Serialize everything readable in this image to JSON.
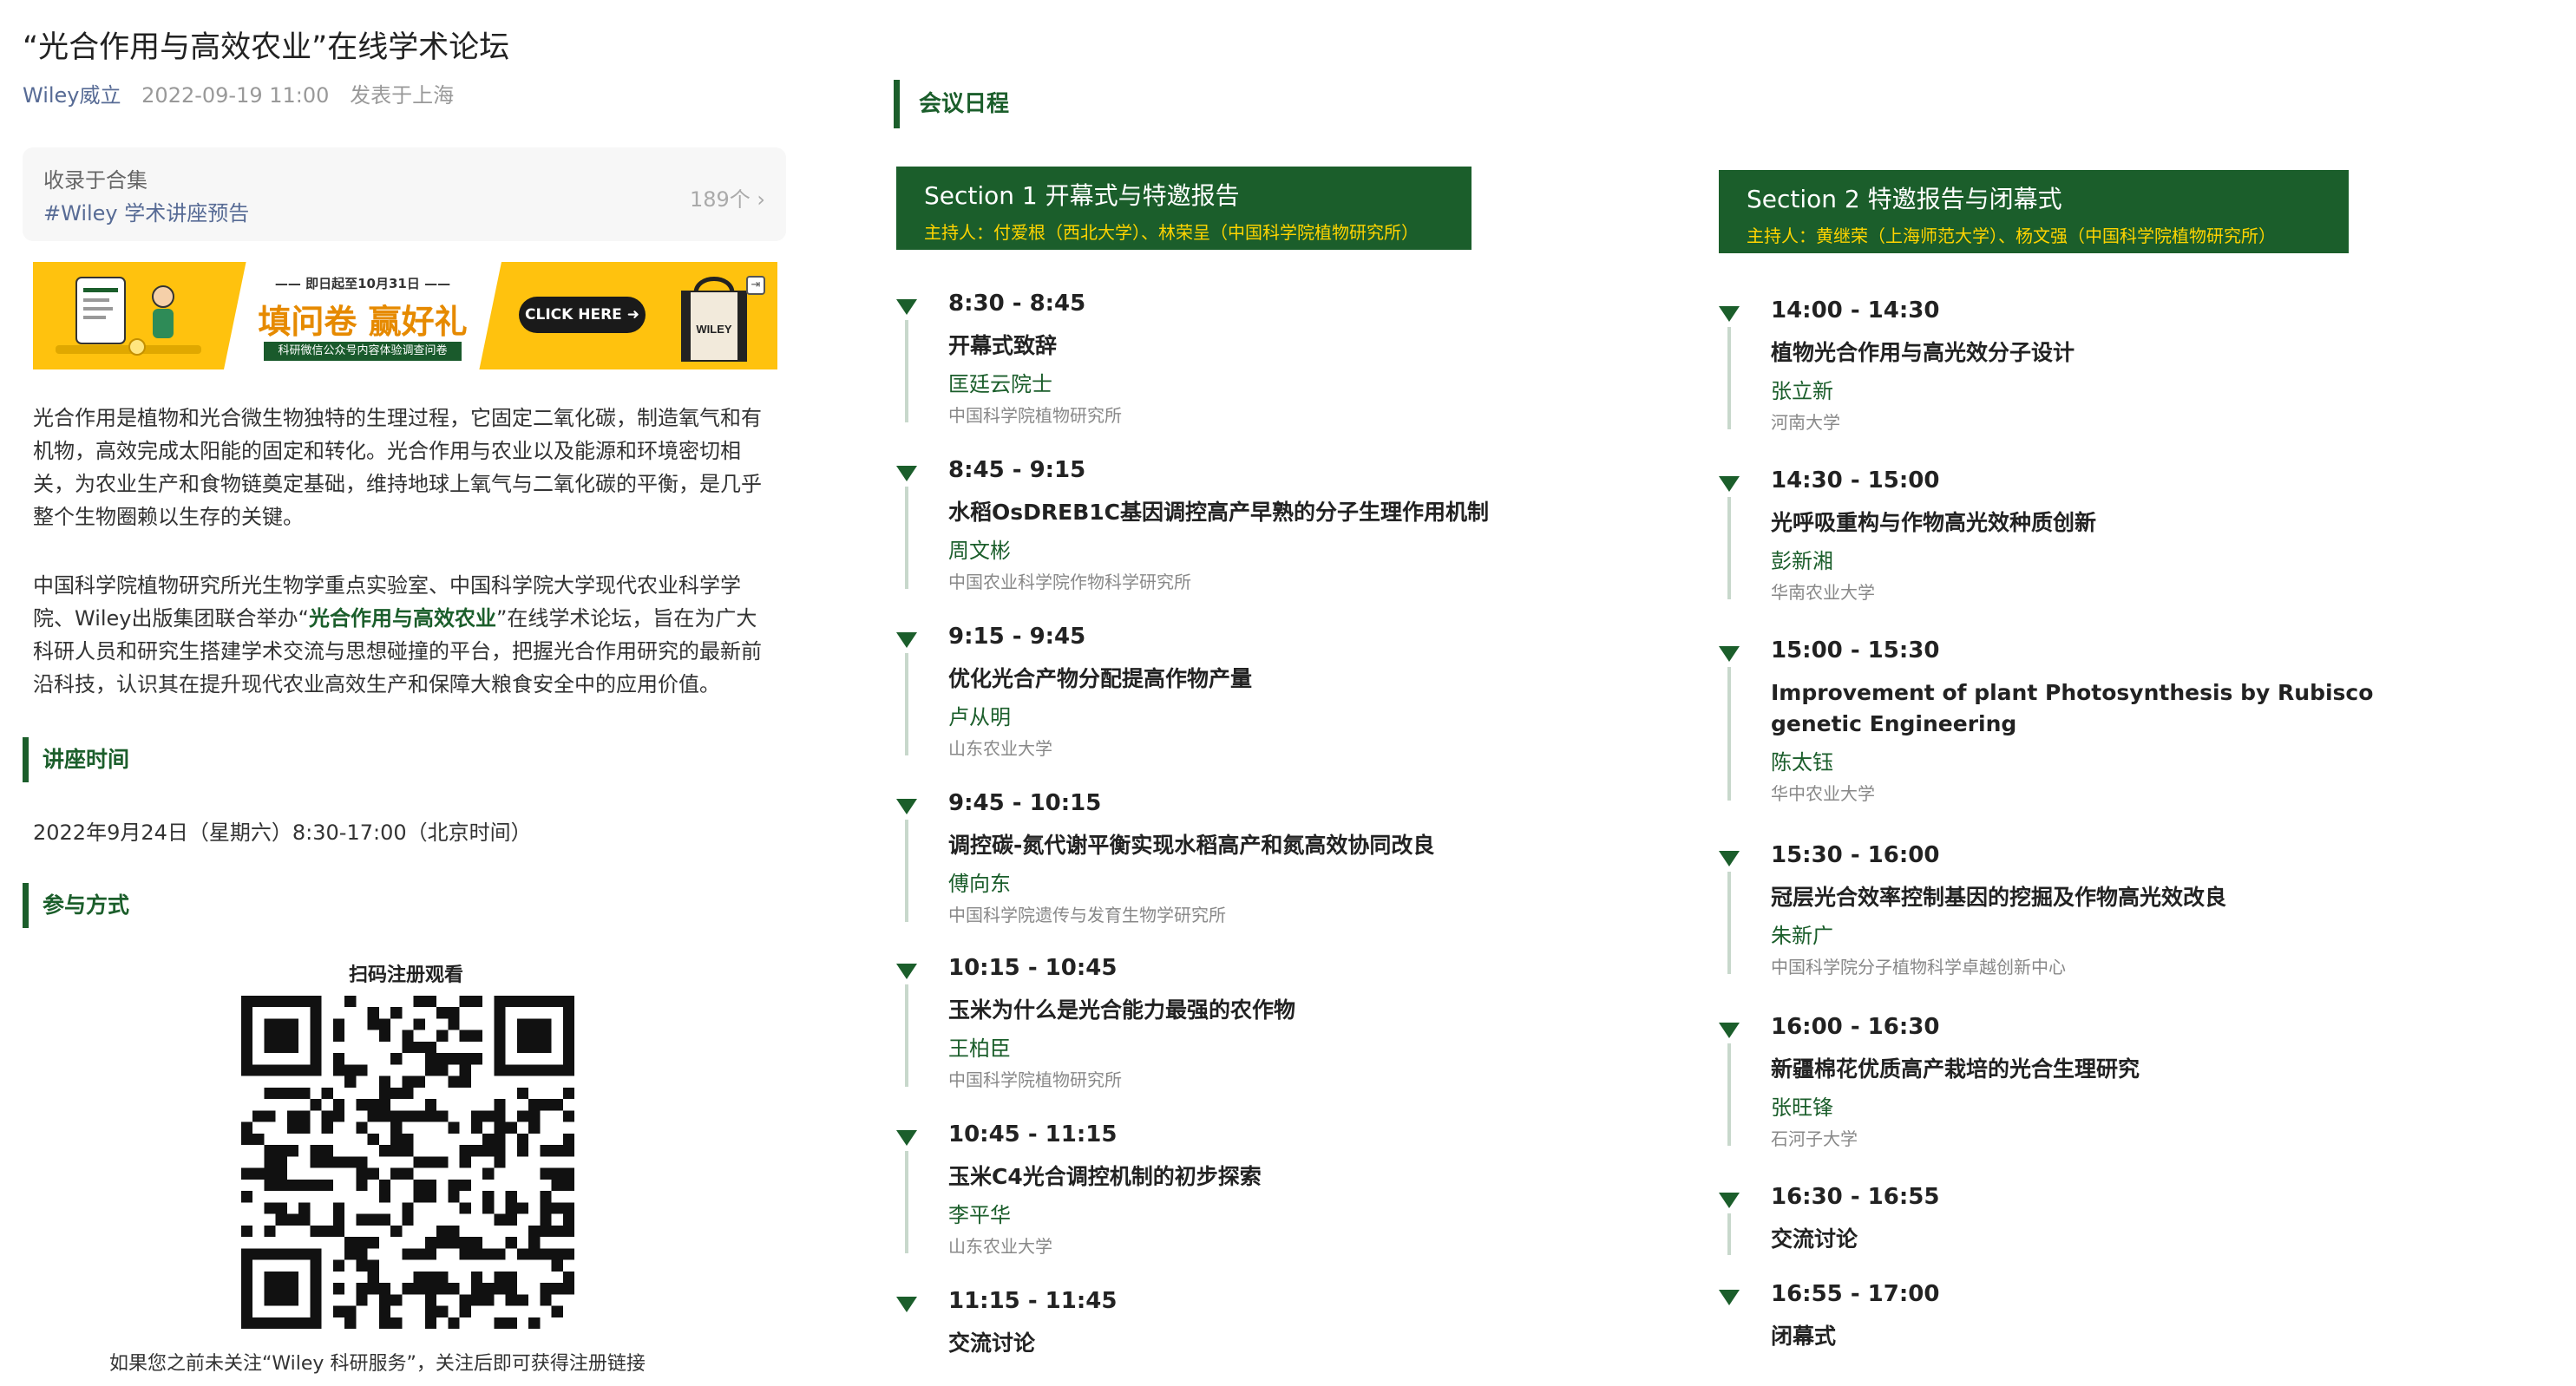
{
  "article": {
    "title": "“光合作用与高效农业”在线学术论坛",
    "author": "Wiley威立",
    "date": "2022-09-19 11:00",
    "location": "发表于上海"
  },
  "collection": {
    "label": "收录于合集",
    "tag": "#Wiley 学术讲座预告",
    "count": "189个 ›"
  },
  "banner": {
    "top_text": "—— 即日起至10月31日 ——",
    "main_text": "填问卷 赢好礼",
    "sub_text": "科研微信公众号内容体验调查问卷",
    "cta": "CLICK HERE ➜",
    "bag_text": "WILEY",
    "corner_icon": "exit-icon"
  },
  "intro": {
    "p1": "光合作用是植物和光合微生物独特的生理过程，它固定二氧化碳，制造氧气和有机物，高效完成太阳能的固定和转化。光合作用与农业以及能源和环境密切相关，为农业生产和食物链奠定基础，维持地球上氧气与二氧化碳的平衡，是几乎整个生物圈赖以生存的关键。",
    "p2_before": "中国科学院植物研究所光生物学重点实验室、中国科学院大学现代农业科学学院、Wiley出版集团联合举办“",
    "p2_highlight": "光合作用与高效农业",
    "p2_after": "”在线学术论坛，旨在为广大科研人员和研究生搭建学术交流与思想碰撞的平台，把握光合作用研究的最新前沿科技，认识其在提升现代农业高效生产和保障大粮食安全中的应用价值。"
  },
  "lecture_time": {
    "heading": "讲座时间",
    "text": "2022年9月24日（星期六）8:30-17:00（北京时间）"
  },
  "participation": {
    "heading": "参与方式",
    "qr_label": "扫码注册观看",
    "note": "如果您之前未关注“Wiley 科研服务”，关注后即可获得注册链接"
  },
  "agenda": {
    "heading": "会议日程",
    "sections": [
      {
        "title": "Section 1 开幕式与特邀报告",
        "hosts": "主持人：付爱根（西北大学）、林荣呈（中国科学院植物研究所）",
        "items": [
          {
            "time": "8:30 - 8:45",
            "topic": "开幕式致辞",
            "speaker": "匡廷云院士",
            "affiliation": "中国科学院植物研究所"
          },
          {
            "time": "8:45 - 9:15",
            "topic": "水稻OsDREB1C基因调控高产早熟的分子生理作用机制",
            "speaker": "周文彬",
            "affiliation": "中国农业科学院作物科学研究所"
          },
          {
            "time": "9:15 - 9:45",
            "topic": "优化光合产物分配提高作物产量",
            "speaker": "卢从明",
            "affiliation": "山东农业大学"
          },
          {
            "time": "9:45 - 10:15",
            "topic": "调控碳-氮代谢平衡实现水稻高产和氮高效协同改良",
            "speaker": "傅向东",
            "affiliation": "中国科学院遗传与发育生物学研究所"
          },
          {
            "time": "10:15 - 10:45",
            "topic": "玉米为什么是光合能力最强的农作物",
            "speaker": "王柏臣",
            "affiliation": "中国科学院植物研究所"
          },
          {
            "time": "10:45 - 11:15",
            "topic": "玉米C4光合调控机制的初步探索",
            "speaker": "李平华",
            "affiliation": "山东农业大学"
          },
          {
            "time": "11:15 - 11:45",
            "topic": "交流讨论",
            "speaker": "",
            "affiliation": ""
          }
        ]
      },
      {
        "title": "Section 2 特邀报告与闭幕式",
        "hosts": "主持人：黄继荣（上海师范大学）、杨文强（中国科学院植物研究所）",
        "items": [
          {
            "time": "14:00 - 14:30",
            "topic": "植物光合作用与高光效分子设计",
            "speaker": "张立新",
            "affiliation": "河南大学"
          },
          {
            "time": "14:30 - 15:00",
            "topic": "光呼吸重构与作物高光效种质创新",
            "speaker": "彭新湘",
            "affiliation": "华南农业大学"
          },
          {
            "time": "15:00 - 15:30",
            "topic": "Improvement of plant Photosynthesis by Rubisco genetic Engineering",
            "speaker": "陈太钰",
            "affiliation": "华中农业大学"
          },
          {
            "time": "15:30 - 16:00",
            "topic": "冠层光合效率控制基因的挖掘及作物高光效改良",
            "speaker": "朱新广",
            "affiliation": "中国科学院分子植物科学卓越创新中心"
          },
          {
            "time": "16:00 - 16:30",
            "topic": "新疆棉花优质高产栽培的光合生理研究",
            "speaker": "张旺锋",
            "affiliation": "石河子大学"
          },
          {
            "time": "16:30 - 16:55",
            "topic": "交流讨论",
            "speaker": "",
            "affiliation": ""
          },
          {
            "time": "16:55 - 17:00",
            "topic": "闭幕式",
            "speaker": "",
            "affiliation": ""
          }
        ]
      }
    ]
  },
  "colors": {
    "brand_green": "#1b5e2b",
    "host_yellow": "#ffd400",
    "link_blue": "#576b95",
    "banner_yellow": "#ffc20e"
  }
}
